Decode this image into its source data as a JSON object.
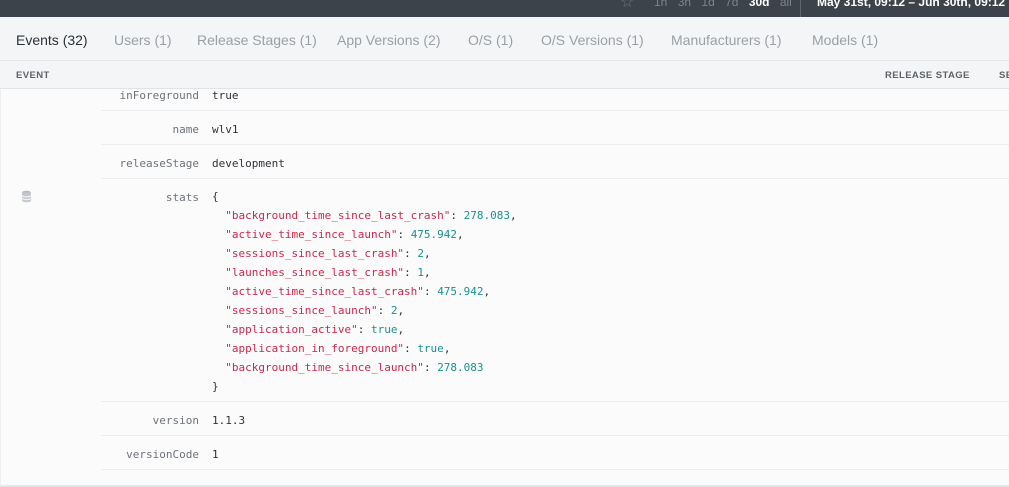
{
  "topbar": {
    "star_icon": "star-icon",
    "ranges": [
      "1h",
      "3h",
      "1d",
      "7d",
      "30d",
      "all"
    ],
    "active_range": "30d",
    "date_range": "May 31st, 09:12  –  Jun 30th, 09:12"
  },
  "tabs": [
    {
      "label": "Events (32)",
      "active": true
    },
    {
      "label": "Users (1)",
      "active": false
    },
    {
      "label": "Release Stages (1)",
      "active": false
    },
    {
      "label": "App Versions (2)",
      "active": false
    },
    {
      "label": "O/S (1)",
      "active": false
    },
    {
      "label": "O/S Versions (1)",
      "active": false
    },
    {
      "label": "Manufacturers (1)",
      "active": false
    },
    {
      "label": "Models (1)",
      "active": false
    }
  ],
  "columns": {
    "event": "EVENT",
    "release_stage": "RELEASE STAGE",
    "se": "SE"
  },
  "metadata": {
    "inForeground": {
      "key": "inForeground",
      "value": "true"
    },
    "name": {
      "key": "name",
      "value": "wlv1"
    },
    "releaseStage": {
      "key": "releaseStage",
      "value": "development"
    },
    "stats": {
      "key": "stats",
      "open": "{",
      "close": "}",
      "entries": [
        {
          "k": "\"background_time_since_last_crash\"",
          "v": "278.083",
          "sep": ","
        },
        {
          "k": "\"active_time_since_launch\"",
          "v": "475.942",
          "sep": ","
        },
        {
          "k": "\"sessions_since_last_crash\"",
          "v": "2",
          "sep": ","
        },
        {
          "k": "\"launches_since_last_crash\"",
          "v": "1",
          "sep": ","
        },
        {
          "k": "\"active_time_since_last_crash\"",
          "v": "475.942",
          "sep": ","
        },
        {
          "k": "\"sessions_since_launch\"",
          "v": "2",
          "sep": ","
        },
        {
          "k": "\"application_active\"",
          "v": "true",
          "sep": ","
        },
        {
          "k": "\"application_in_foreground\"",
          "v": "true",
          "sep": ","
        },
        {
          "k": "\"background_time_since_launch\"",
          "v": "278.083",
          "sep": ""
        }
      ]
    },
    "version": {
      "key": "version",
      "value": "1.1.3"
    },
    "versionCode": {
      "key": "versionCode",
      "value": "1"
    }
  },
  "icons": {
    "database": "database-icon"
  }
}
